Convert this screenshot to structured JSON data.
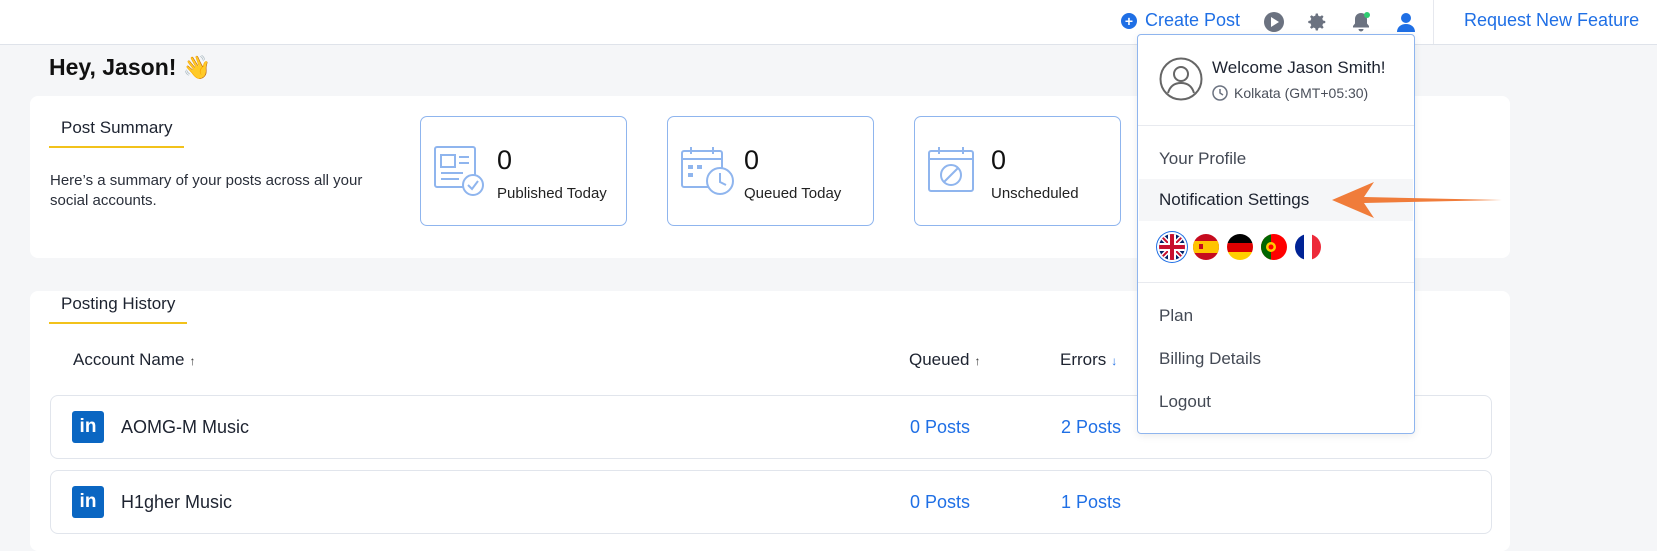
{
  "topbar": {
    "create_post": "Create Post",
    "request_feature": "Request New Feature",
    "icons": [
      "play-icon",
      "gear-icon",
      "bell-icon",
      "user-icon"
    ]
  },
  "greeting": "Hey, Jason! 👋",
  "summary": {
    "tab": "Post Summary",
    "description": "Here’s a summary of your posts across all your social accounts.",
    "stats": [
      {
        "value": "0",
        "label": "Published Today",
        "icon": "published-icon"
      },
      {
        "value": "0",
        "label": "Queued Today",
        "icon": "queued-calendar-icon"
      },
      {
        "value": "0",
        "label": "Unscheduled",
        "icon": "unscheduled-calendar-icon"
      }
    ]
  },
  "history": {
    "tab": "Posting History",
    "columns": {
      "account": "Account Name",
      "queued": "Queued",
      "errors": "Errors",
      "arrow_up": "↑",
      "arrow_down": "↓"
    },
    "rows": [
      {
        "platform_badge": "in",
        "name": "AOMG-M Music",
        "queued": "0 Posts",
        "errors": "2 Posts"
      },
      {
        "platform_badge": "in",
        "name": "H1gher Music",
        "queued": "0 Posts",
        "errors": "1 Posts"
      }
    ]
  },
  "profile_menu": {
    "welcome": "Welcome Jason Smith!",
    "timezone": "Kolkata (GMT+05:30)",
    "items_top": [
      "Your Profile",
      "Notification Settings"
    ],
    "languages": [
      "uk-flag",
      "spain-flag",
      "germany-flag",
      "portugal-flag",
      "france-flag"
    ],
    "items_bottom": [
      "Plan",
      "Billing Details",
      "Logout"
    ]
  },
  "colors": {
    "accent": "#1f6fe5",
    "tab_underline": "#f2c21b",
    "annotation_arrow": "#f07c3a",
    "linkedin": "#0a66c2"
  }
}
